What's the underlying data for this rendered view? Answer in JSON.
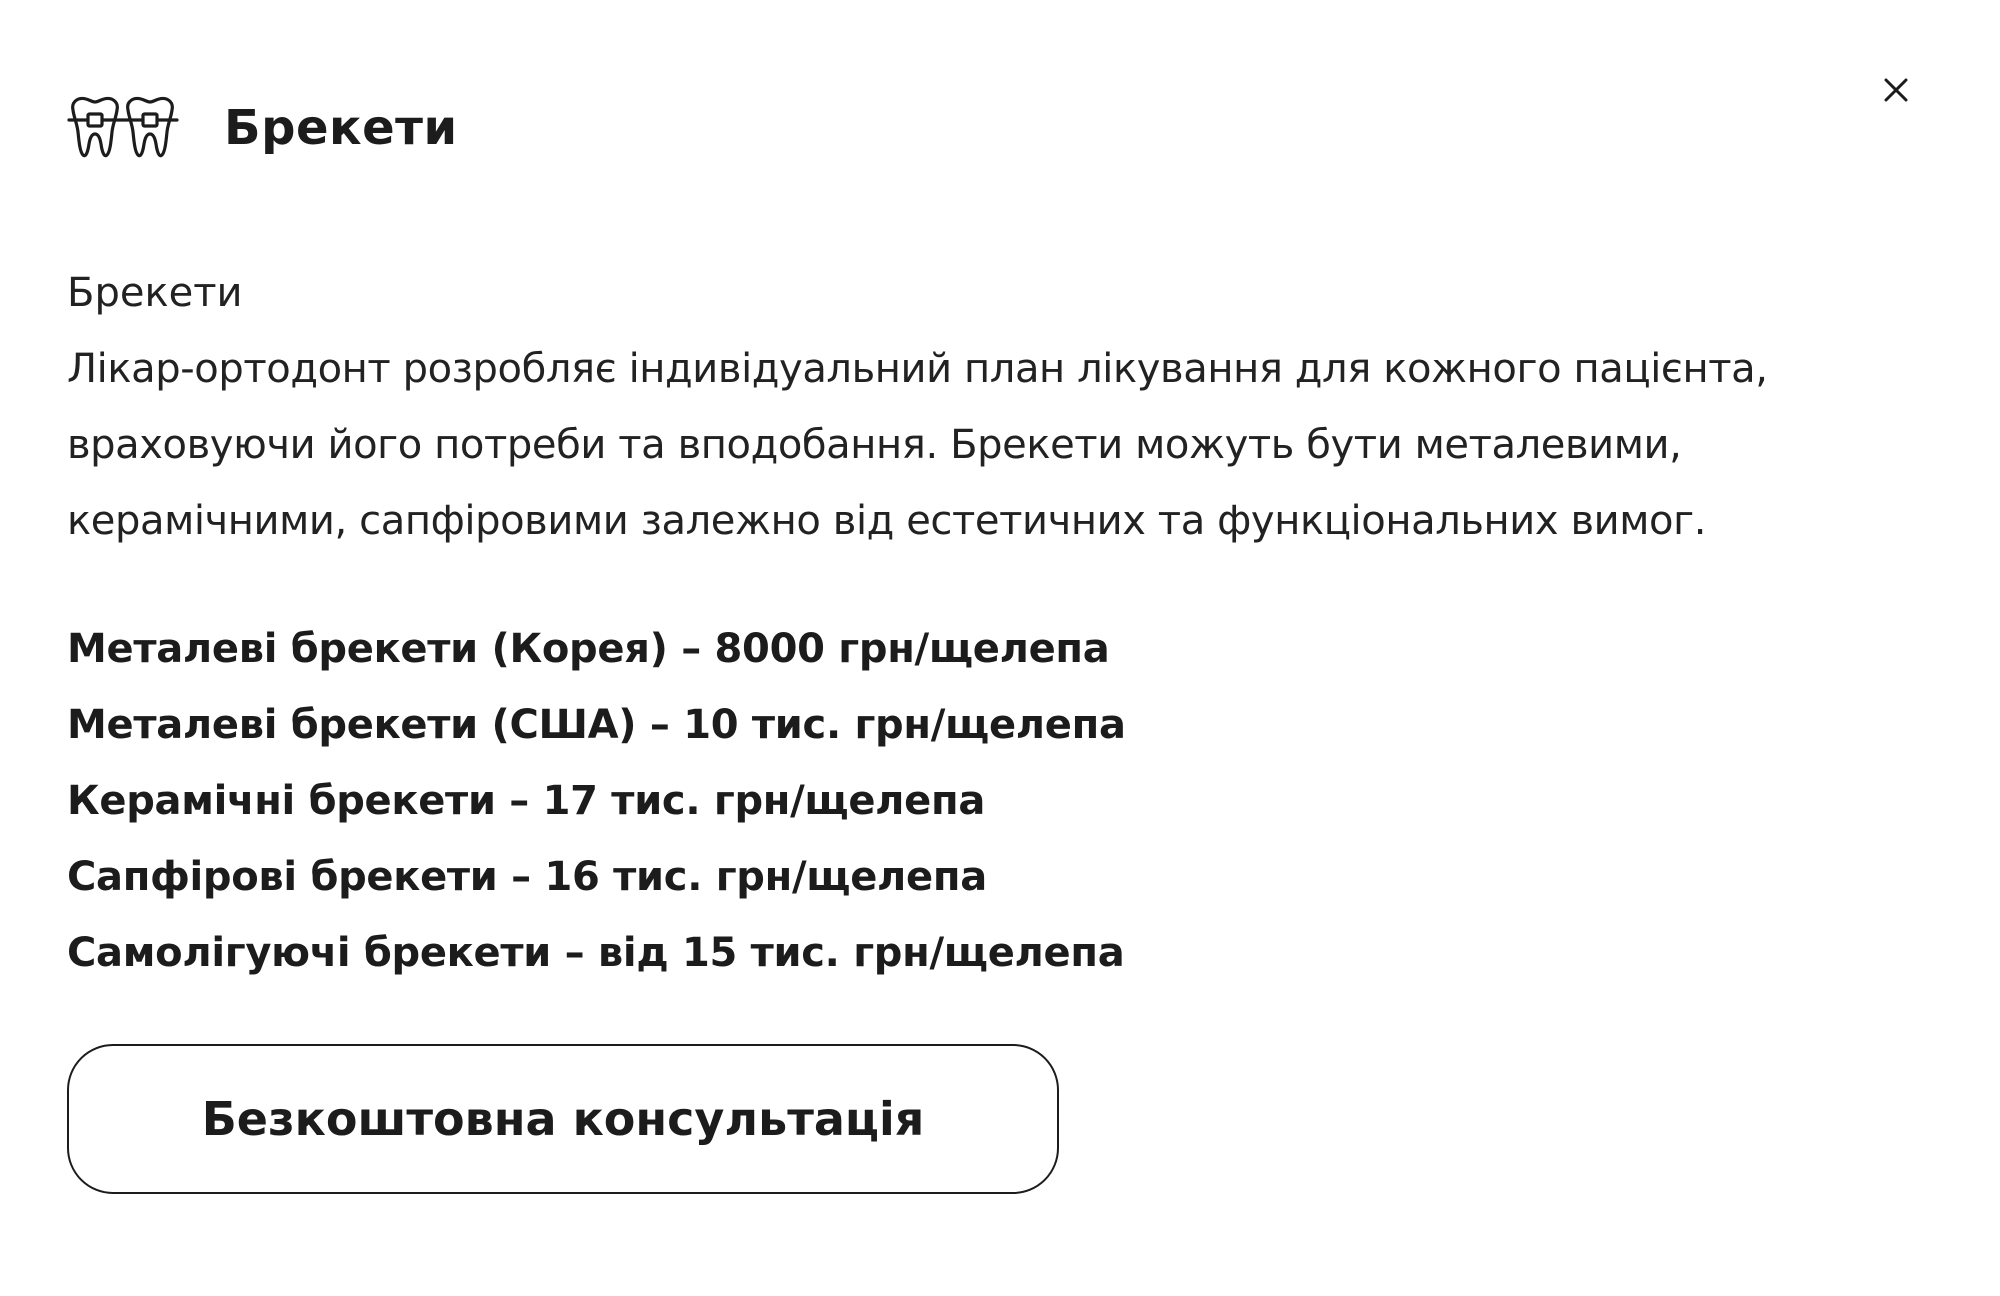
{
  "modal": {
    "header": {
      "title": "Брекети",
      "icon": "braces-teeth-icon"
    },
    "close_icon": "close-icon",
    "description": {
      "title": "Брекети",
      "text": "Лікар-ортодонт розробляє індивідуальний план лікування для кожного пацієнта, враховуючи його потреби та вподобання. Брекети можуть бути металевими, керамічними, сапфіровими залежно від естетичних та функціональних вимог."
    },
    "prices": [
      "Металеві брекети (Корея) – 8000 грн/щелепа",
      "Металеві брекети (США) – 10 тис. грн/щелепа",
      "Керамічні брекети – 17 тис. грн/щелепа",
      "Сапфірові брекети – 16 тис. грн/щелепа",
      "Самолігуючі брекети – від 15 тис. грн/щелепа"
    ],
    "cta_label": "Безкоштовна консультація"
  },
  "colors": {
    "text": "#1c1c1c",
    "background": "#ffffff",
    "border": "#1c1c1c"
  }
}
